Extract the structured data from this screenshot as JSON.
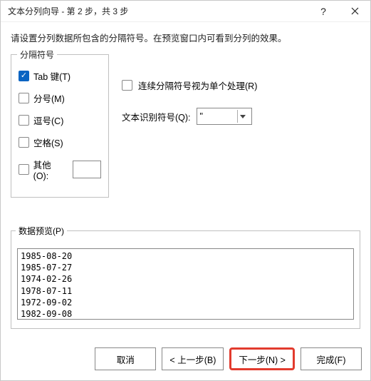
{
  "titlebar": {
    "title": "文本分列向导 - 第 2 步，共 3 步"
  },
  "instruction": "请设置分列数据所包含的分隔符号。在预览窗口内可看到分列的效果。",
  "delimiters": {
    "legend": "分隔符号",
    "tab_label": "Tab 键(T)",
    "tab_checked": true,
    "semicolon_label": "分号(M)",
    "semicolon_checked": false,
    "comma_label": "逗号(C)",
    "comma_checked": false,
    "space_label": "空格(S)",
    "space_checked": false,
    "other_label": "其他(O):",
    "other_checked": false,
    "other_value": ""
  },
  "options": {
    "consecutive_label": "连续分隔符号视为单个处理(R)",
    "consecutive_checked": false,
    "text_qualifier_label": "文本识别符号(Q):",
    "text_qualifier_value": "\""
  },
  "preview": {
    "legend": "数据预览(P)",
    "lines": [
      "1985-08-20",
      "1985-07-27",
      "1974-02-26",
      "1978-07-11",
      "1972-09-02",
      "1982-09-08"
    ]
  },
  "buttons": {
    "cancel": "取消",
    "back": "< 上一步(B)",
    "next": "下一步(N) >",
    "finish": "完成(F)"
  }
}
